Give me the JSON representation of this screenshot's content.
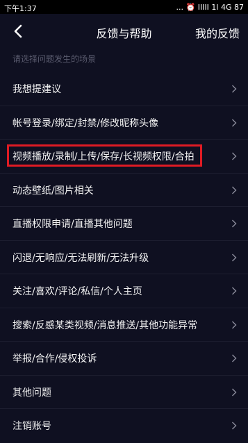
{
  "status_bar": {
    "time": "下午1:37",
    "indicators": "... ⏰ IIIII 1l 4G 87"
  },
  "nav": {
    "title": "反馈与帮助",
    "right_action": "我的反馈",
    "back_icon": "chevron-left-icon"
  },
  "hint": "请选择问题发生的场景",
  "items": [
    {
      "label": "我想提建议"
    },
    {
      "label": "帐号登录/绑定/封禁/修改昵称头像"
    },
    {
      "label": "视频播放/录制/上传/保存/长视频权限/合拍"
    },
    {
      "label": "动态壁纸/图片相关"
    },
    {
      "label": "直播权限申请/直播其他问题"
    },
    {
      "label": "闪退/无响应/无法刷新/无法升级"
    },
    {
      "label": "关注/喜欢/评论/私信/个人主页"
    },
    {
      "label": "搜索/反感某类视频/消息推送/其他功能异常"
    },
    {
      "label": "举报/合作/侵权投诉"
    },
    {
      "label": "其他问题"
    },
    {
      "label": "注销账号"
    }
  ],
  "highlighted_item_index": 2,
  "colors": {
    "background": "#0f1021",
    "highlight_border": "#e01b24",
    "hint_text": "#5a5b6e"
  }
}
